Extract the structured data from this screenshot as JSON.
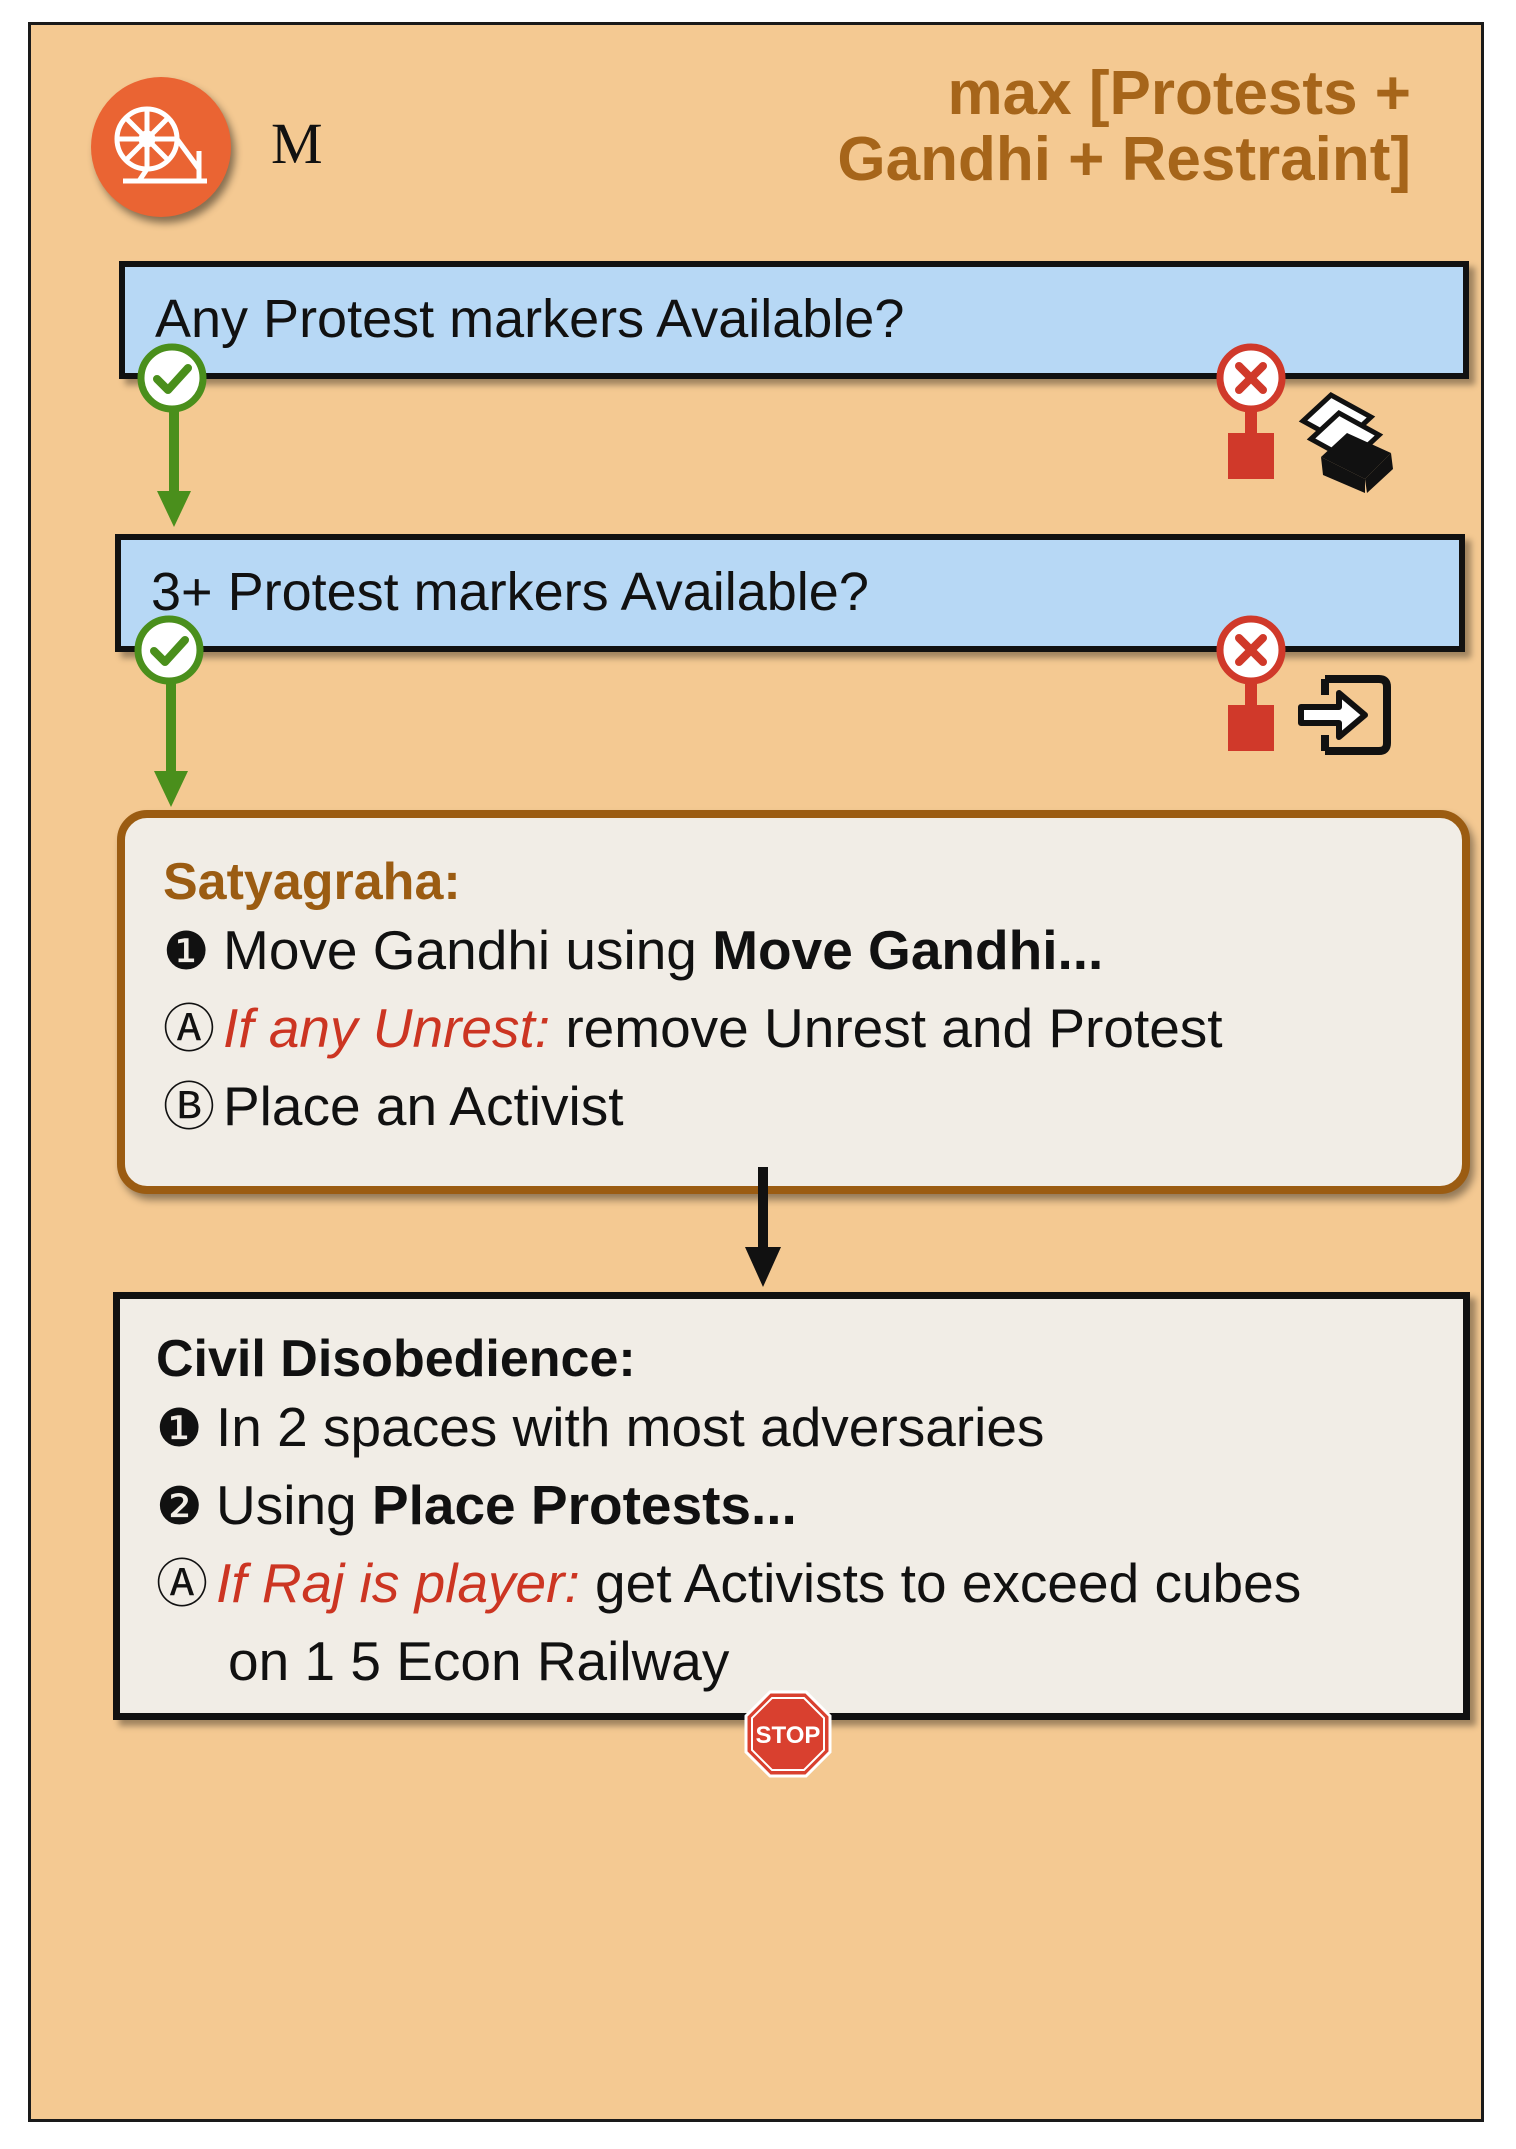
{
  "card": {
    "letter": "M",
    "priority_line1": "max [Protests +",
    "priority_line2": "Gandhi + Restraint]",
    "faction_icon": "spinning-wheel-icon"
  },
  "questions": [
    {
      "text": "Any Protest markers Available?",
      "no_icon": "cards-stack-icon"
    },
    {
      "text": "3+ Protest markers Available?",
      "no_icon": "exit-icon"
    }
  ],
  "satyagraha": {
    "heading": "Satyagraha:",
    "step1": {
      "marker": "❶",
      "text": "Move Gandhi using ",
      "bold": "Move Gandhi..."
    },
    "stepA": {
      "marker": "Ⓐ",
      "cond": "If any Unrest:",
      "text": " remove Unrest and Protest"
    },
    "stepB": {
      "marker": "Ⓑ",
      "text": "Place an Activist"
    }
  },
  "civil_disobedience": {
    "heading": "Civil Disobedience:",
    "step1": {
      "marker": "❶",
      "text": "In 2 spaces with most adversaries"
    },
    "step2": {
      "marker": "❷",
      "text": "Using ",
      "bold": "Place Protests..."
    },
    "stepA": {
      "marker": "Ⓐ",
      "cond": "If Raj is player:",
      "text": " get Activists to exceed cubes",
      "text2": "on 1 5 Econ Railway"
    }
  },
  "stop_label": "STOP",
  "colors": {
    "card_bg": "#f4c992",
    "question_bg": "#b7d8f5",
    "yes_green": "#4a8f1c",
    "no_red": "#d0392a",
    "accent_brown": "#9b5c12",
    "header_brown": "#a6651a",
    "condition_red": "#cc3522"
  }
}
